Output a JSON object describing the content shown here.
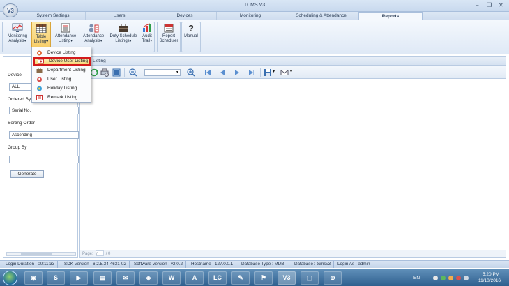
{
  "window": {
    "title": "TCMS V3",
    "logo": "V3",
    "minimize": "–",
    "restore": "❐",
    "close": "✕"
  },
  "tabs": [
    "System Settings",
    "Users",
    "Devices",
    "Monitoring",
    "Scheduling & Attendance",
    "Reports"
  ],
  "active_tab": "Reports",
  "ribbon": {
    "buttons": [
      {
        "line1": "Monitoring",
        "line2": "Analysis",
        "icon": "monitor-chart-icon"
      },
      {
        "line1": "Table",
        "line2": "Listing",
        "icon": "table-icon"
      },
      {
        "line1": "Attendance",
        "line2": "Listing",
        "icon": "list-icon"
      },
      {
        "line1": "Attendance",
        "line2": "Analysis",
        "icon": "users-analysis-icon"
      },
      {
        "line1": "Duty Schedule",
        "line2": "Listings",
        "icon": "briefcase-icon"
      },
      {
        "line1": "Audit",
        "line2": "Trail",
        "icon": "bar-chart-icon"
      },
      {
        "line1": "Report",
        "line2": "Scheduler",
        "icon": "report-scheduler-icon"
      },
      {
        "line1": "Manual",
        "line2": "",
        "icon": "help-icon"
      }
    ]
  },
  "dropdown": {
    "items": [
      {
        "label": "Device Listing",
        "icon": "device-listing-icon"
      },
      {
        "label": "Device User Listing",
        "icon": "device-user-icon",
        "selected": true
      },
      {
        "label": "Department Listing",
        "icon": "department-icon"
      },
      {
        "label": "User Listing",
        "icon": "user-listing-icon"
      },
      {
        "label": "Holiday Listing",
        "icon": "holiday-icon"
      },
      {
        "label": "Remark Listing",
        "icon": "remark-icon"
      }
    ]
  },
  "left_panel": {
    "device_label": "Device",
    "device_value": "ALL",
    "ordered_by_label": "Ordered By",
    "ordered_by_value": "Serial No.",
    "sorting_order_label": "Sorting Order",
    "sorting_order_value": "Ascending",
    "group_by_label": "Group By",
    "group_by_value": "",
    "generate_label": "Generate"
  },
  "report_panel": {
    "header_title": "Listing",
    "page_label": "Page:",
    "page_value": "0",
    "page_total": "/ 0"
  },
  "status_bar": [
    {
      "text": "Login Duration : 00:11:33"
    },
    {
      "text": "SDK Version : 6.2.5.34-4631-02"
    },
    {
      "text": "Software Version : v2.0.2"
    },
    {
      "text": "Hostname : 127.0.0.1"
    },
    {
      "text": "Database Type : MDB"
    },
    {
      "text": "Database : tcmsv3"
    },
    {
      "text": "Login As : admin"
    }
  ],
  "taskbar": {
    "apps": [
      "chrome",
      "skype",
      "cmd",
      "explorer",
      "outlook",
      "tcms",
      "word-w",
      "app-a",
      "lc",
      "notepad",
      "app-flag",
      "v3",
      "monitor",
      "app-s"
    ],
    "app_glyphs": [
      "◉",
      "S",
      "▶",
      "▤",
      "✉",
      "◈",
      "W",
      "A",
      "LC",
      "✎",
      "⚑",
      "V3",
      "▢",
      "⊕"
    ],
    "language": "EN",
    "time": "5:20 PM",
    "date": "11/10/2016"
  },
  "colors": {
    "accent_highlight": "#f6c95e",
    "selection_border": "#d41b1b",
    "taskbar": "#2e5f8e"
  }
}
